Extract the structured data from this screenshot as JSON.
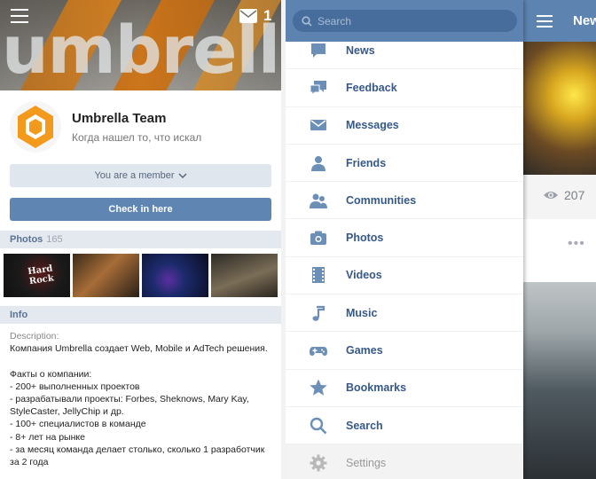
{
  "left": {
    "cover": {
      "word": "umbrella",
      "badge_count": "1"
    },
    "group": {
      "name": "Umbrella Team",
      "status": "Когда нашел то, что искал"
    },
    "member_button": "You are a member",
    "checkin_button": "Check in here",
    "photos_section": {
      "title": "Photos",
      "count": "165"
    },
    "photo_thumbs": [
      {
        "caption": "Hard Rock"
      },
      {
        "caption": ""
      },
      {
        "caption": ""
      },
      {
        "caption": ""
      }
    ],
    "info_section": {
      "title": "Info"
    },
    "description": {
      "label": "Description:",
      "lines": [
        "Компания Umbrella создает Web, Mobile и AdTech решения.",
        "",
        "Факты о компании:",
        "- 200+ выполненных проектов",
        "- разрабатывали проекты: Forbes, Sheknows, Mary Kay, StyleCaster, JellyChip и др.",
        "- 100+ специалистов в команде",
        "- 8+ лет на рынке",
        "- за месяц команда делает столько, сколько 1 разработчик за 2 года"
      ]
    }
  },
  "right": {
    "search_placeholder": "Search",
    "background": {
      "title": "New",
      "views": "207",
      "more": "•••"
    },
    "menu": [
      {
        "label": "News",
        "icon": "news-icon"
      },
      {
        "label": "Feedback",
        "icon": "feedback-icon"
      },
      {
        "label": "Messages",
        "icon": "messages-icon"
      },
      {
        "label": "Friends",
        "icon": "friends-icon"
      },
      {
        "label": "Communities",
        "icon": "communities-icon"
      },
      {
        "label": "Photos",
        "icon": "camera-icon"
      },
      {
        "label": "Videos",
        "icon": "film-icon"
      },
      {
        "label": "Music",
        "icon": "music-note-icon"
      },
      {
        "label": "Games",
        "icon": "gamepad-icon"
      },
      {
        "label": "Bookmarks",
        "icon": "star-icon"
      },
      {
        "label": "Search",
        "icon": "search-icon"
      },
      {
        "label": "Settings",
        "icon": "gear-icon"
      }
    ]
  },
  "colors": {
    "header_blue": "#5d83b0",
    "search_blue": "#466d9c",
    "accent_button": "#5f85b3",
    "menu_text": "#36598a",
    "icon_blue": "#6c8fb8",
    "logo_orange": "#f39a1c"
  }
}
